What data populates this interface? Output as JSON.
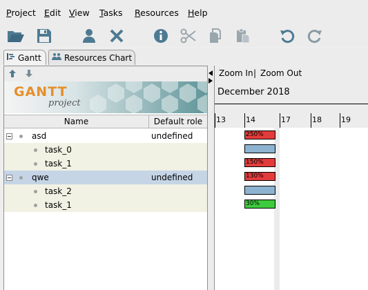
{
  "menu": [
    "Project",
    "Edit",
    "View",
    "Tasks",
    "Resources",
    "Help"
  ],
  "menu_mnemonic": [
    "P",
    "E",
    "V",
    "T",
    "R",
    "H"
  ],
  "tabs": [
    {
      "label": "Gantt",
      "icon": "gantt-icon"
    },
    {
      "label": "Resources Chart",
      "icon": "resources-chart-icon"
    }
  ],
  "toolbar": [
    "open-folder-icon",
    "save-icon",
    "add-person-icon",
    "delete-icon",
    "info-icon",
    "cut-icon",
    "copy-icon",
    "paste-icon",
    "undo-icon",
    "redo-icon"
  ],
  "banner": {
    "logo": "GANTT",
    "logo_sub": "project"
  },
  "table": {
    "columns": [
      "Name",
      "Default role"
    ],
    "rows": [
      {
        "name": "asd",
        "role": "undefined",
        "level": 0
      },
      {
        "name": "task_0",
        "role": "",
        "level": 1
      },
      {
        "name": "task_1",
        "role": "",
        "level": 1
      },
      {
        "name": "qwe",
        "role": "undefined",
        "level": 0,
        "selected": true
      },
      {
        "name": "task_2",
        "role": "",
        "level": 1
      },
      {
        "name": "task_1",
        "role": "",
        "level": 1
      }
    ]
  },
  "chart": {
    "zoom_in": "Zoom In",
    "zoom_out": "Zoom Out",
    "separator": "|",
    "month": "December 2018",
    "days": [
      "13",
      "14",
      "17",
      "18",
      "19"
    ],
    "loads": [
      {
        "label": "250%",
        "color": "#e33b3b"
      },
      {
        "label": "",
        "color": "#8db3d0"
      },
      {
        "label": "150%",
        "color": "#e33b3b"
      },
      {
        "label": "130%",
        "color": "#e33b3b"
      },
      {
        "label": "",
        "color": "#8db3d0"
      },
      {
        "label": "30%",
        "color": "#3ecb3e"
      }
    ]
  }
}
